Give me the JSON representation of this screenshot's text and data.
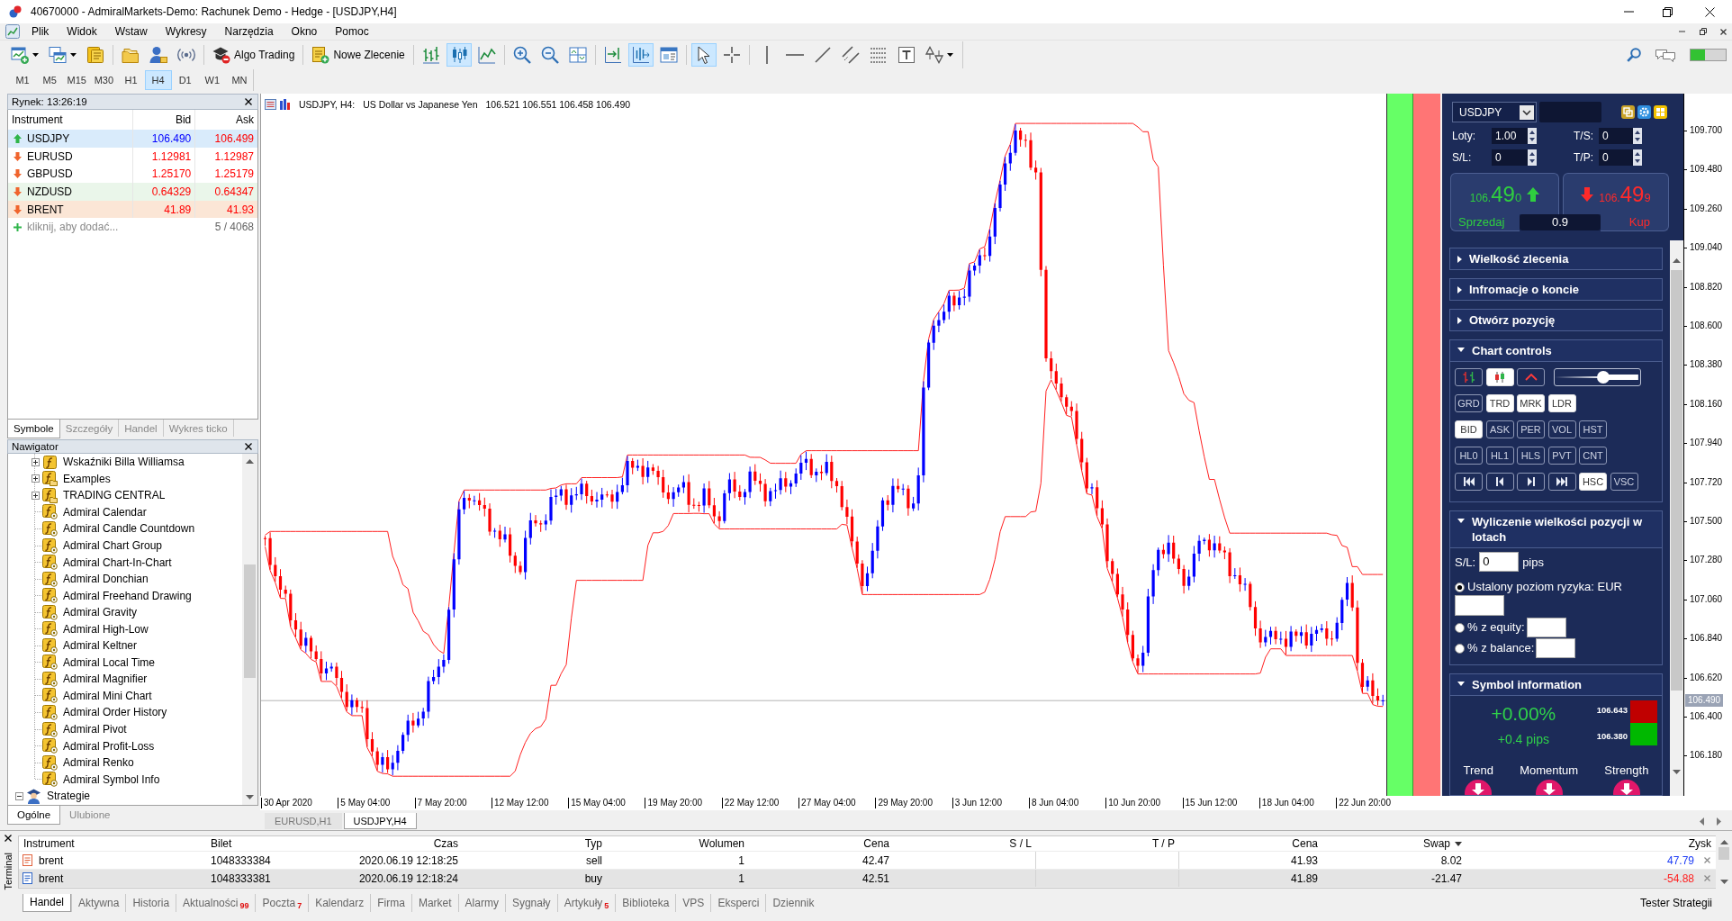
{
  "window": {
    "title": "40670000 - AdmiralMarkets-Demo: Rachunek Demo - Hedge - [USDJPY,H4]"
  },
  "menu": [
    "Plik",
    "Widok",
    "Wstaw",
    "Wykresy",
    "Narzędzia",
    "Okno",
    "Pomoc"
  ],
  "toolbar": {
    "groups": [
      [
        {
          "kind": "dropdown",
          "selected": false
        },
        {
          "kind": "dropdown",
          "selected": false
        },
        {
          "kind": "icon",
          "selected": false
        }
      ],
      [
        {
          "kind": "icon",
          "selected": false
        },
        {
          "kind": "icon",
          "selected": false
        },
        {
          "kind": "icon",
          "selected": false
        }
      ],
      [
        {
          "kind": "text",
          "label": "Algo Trading",
          "selected": false
        }
      ],
      [
        {
          "kind": "text",
          "label": "Nowe Zlecenie",
          "selected": false
        }
      ],
      [
        {
          "kind": "icon",
          "selected": false
        },
        {
          "kind": "icon",
          "selected": true
        },
        {
          "kind": "icon",
          "selected": false
        }
      ],
      [
        {
          "kind": "icon",
          "selected": false
        },
        {
          "kind": "icon",
          "selected": false
        },
        {
          "kind": "icon",
          "selected": false
        }
      ],
      [
        {
          "kind": "icon",
          "selected": false
        },
        {
          "kind": "icon",
          "selected": true
        },
        {
          "kind": "icon",
          "selected": false
        }
      ],
      [
        {
          "kind": "icon",
          "selected": true
        },
        {
          "kind": "icon",
          "selected": false
        }
      ],
      [
        {
          "kind": "icon",
          "selected": false
        },
        {
          "kind": "icon",
          "selected": false
        },
        {
          "kind": "icon",
          "selected": false
        },
        {
          "kind": "icon",
          "selected": false
        },
        {
          "kind": "icon",
          "selected": false
        },
        {
          "kind": "icon",
          "selected": false
        },
        {
          "kind": "dropdown",
          "selected": false
        }
      ]
    ]
  },
  "timeframes": [
    {
      "label": "M1",
      "selected": false
    },
    {
      "label": "M5",
      "selected": false
    },
    {
      "label": "M15",
      "selected": false
    },
    {
      "label": "M30",
      "selected": false
    },
    {
      "label": "H1",
      "selected": false
    },
    {
      "label": "H4",
      "selected": true
    },
    {
      "label": "D1",
      "selected": false
    },
    {
      "label": "W1",
      "selected": false
    },
    {
      "label": "MN",
      "selected": false
    }
  ],
  "market_watch": {
    "title": "Rynek: 13:26:19",
    "columns": [
      "Instrument",
      "Bid",
      "Ask"
    ],
    "rows": [
      {
        "symbol": "USDJPY",
        "bid": "106.490",
        "ask": "106.499",
        "bid_up": true,
        "ask_up": false,
        "selected": true
      },
      {
        "symbol": "EURUSD",
        "bid": "1.12981",
        "ask": "1.12987",
        "bid_up": false,
        "ask_up": false,
        "selected": false
      },
      {
        "symbol": "GBPUSD",
        "bid": "1.25170",
        "ask": "1.25179",
        "bid_up": false,
        "ask_up": false,
        "selected": false
      },
      {
        "symbol": "NZDUSD",
        "bid": "0.64329",
        "ask": "0.64347",
        "bid_up": false,
        "ask_up": false,
        "selected": false,
        "color": "#eaf6ea"
      },
      {
        "symbol": "BRENT",
        "bid": "41.89",
        "ask": "41.93",
        "bid_up": false,
        "ask_up": false,
        "selected": false,
        "color": "#fbe6d6"
      }
    ],
    "add_row": {
      "label": "kliknij, aby dodać...",
      "count": "5 / 4068"
    },
    "tabs": [
      {
        "label": "Symbole",
        "selected": true
      },
      {
        "label": "Szczegóły",
        "selected": false
      },
      {
        "label": "Handel",
        "selected": false
      },
      {
        "label": "Wykres ticko",
        "selected": false
      }
    ]
  },
  "navigator": {
    "title": "Nawigator",
    "tree": [
      {
        "children": [
          {
            "label": "Wskaźniki Billa Williamsa",
            "kind": "group",
            "expanded": false
          },
          {
            "label": "Examples",
            "kind": "folder",
            "expanded": false
          },
          {
            "label": "TRADING CENTRAL",
            "kind": "folder",
            "expanded": false
          },
          {
            "label": "Admiral Calendar",
            "kind": "indicator"
          },
          {
            "label": "Admiral Candle Countdown",
            "kind": "indicator"
          },
          {
            "label": "Admiral Chart Group",
            "kind": "indicator"
          },
          {
            "label": "Admiral Chart-In-Chart",
            "kind": "indicator"
          },
          {
            "label": "Admiral Donchian",
            "kind": "indicator"
          },
          {
            "label": "Admiral Freehand Drawing",
            "kind": "indicator"
          },
          {
            "label": "Admiral Gravity",
            "kind": "indicator"
          },
          {
            "label": "Admiral High-Low",
            "kind": "indicator"
          },
          {
            "label": "Admiral Keltner",
            "kind": "indicator"
          },
          {
            "label": "Admiral Local Time",
            "kind": "indicator"
          },
          {
            "label": "Admiral Magnifier",
            "kind": "indicator"
          },
          {
            "label": "Admiral Mini Chart",
            "kind": "indicator"
          },
          {
            "label": "Admiral Order History",
            "kind": "indicator"
          },
          {
            "label": "Admiral Pivot",
            "kind": "indicator"
          },
          {
            "label": "Admiral Profit-Loss",
            "kind": "indicator"
          },
          {
            "label": "Admiral Renko",
            "kind": "indicator"
          },
          {
            "label": "Admiral Symbol Info",
            "kind": "indicator"
          }
        ]
      },
      {
        "label": "Strategie",
        "kind": "experts",
        "expanded": true
      }
    ],
    "tabs": [
      {
        "label": "Ogólne",
        "selected": true
      },
      {
        "label": "Ulubione",
        "selected": false
      }
    ]
  },
  "chart": {
    "symbol": "USDJPY, H4:",
    "description": "US Dollar vs Japanese Yen",
    "ohlc": "106.521 106.551 106.458 106.490",
    "price_labels": [
      "109.700",
      "109.480",
      "109.260",
      "109.040",
      "108.820",
      "108.600",
      "108.380",
      "108.160",
      "107.940",
      "107.720",
      "107.500",
      "107.280",
      "107.060",
      "106.840",
      "106.620",
      "106.400",
      "106.180"
    ],
    "current_price": "106.490",
    "time_labels": [
      "30 Apr 2020",
      "5 May 04:00",
      "7 May 20:00",
      "12 May 12:00",
      "15 May 04:00",
      "19 May 20:00",
      "22 May 12:00",
      "27 May 04:00",
      "29 May 20:00",
      "3 Jun 12:00",
      "8 Jun 04:00",
      "10 Jun 20:00",
      "15 Jun 12:00",
      "18 Jun 04:00",
      "22 Jun 20:00"
    ],
    "tabs": [
      {
        "label": "EURUSD,H1",
        "selected": false
      },
      {
        "label": "USDJPY,H4",
        "selected": true
      }
    ]
  },
  "trade_panel": {
    "symbol": "USDJPY",
    "fields": [
      {
        "label": "Loty:",
        "value": "1.00"
      },
      {
        "label": "T/S:",
        "value": "0"
      },
      {
        "label": "S/L:",
        "value": "0"
      },
      {
        "label": "T/P:",
        "value": "0"
      }
    ],
    "sell": {
      "price_prefix": "106.",
      "price_main": "49",
      "price_suffix": "0",
      "label": "Sprzedaj"
    },
    "buy": {
      "price_prefix": "106.",
      "price_main": "49",
      "price_suffix": "9",
      "label": "Kup"
    },
    "spread": "0.9",
    "sections": [
      {
        "kind": "plain",
        "title": "Wielkość zlecenia",
        "expanded": false
      },
      {
        "kind": "plain",
        "title": "Infromacje o koncie",
        "expanded": false
      },
      {
        "kind": "plain",
        "title": "Otwórz pozycję",
        "expanded": false
      },
      {
        "kind": "chart_controls",
        "title": "Chart controls",
        "expanded": true,
        "rows": [
          [
            {
              "kind": "icon",
              "on": false
            },
            {
              "kind": "icon",
              "on": true
            },
            {
              "kind": "icon",
              "on": false
            },
            {
              "kind": "slider",
              "level": 0.57
            }
          ],
          [
            {
              "kind": "text",
              "label": "GRD",
              "on": false
            },
            {
              "kind": "text",
              "label": "TRD",
              "on": true
            },
            {
              "kind": "text",
              "label": "MRK",
              "on": true
            },
            {
              "kind": "text",
              "label": "LDR",
              "on": true
            }
          ],
          [
            {
              "kind": "text",
              "label": "BID",
              "on": true
            },
            {
              "kind": "text",
              "label": "ASK",
              "on": false
            },
            {
              "kind": "text",
              "label": "PER",
              "on": false
            },
            {
              "kind": "text",
              "label": "VOL",
              "on": false
            },
            {
              "kind": "text",
              "label": "HST",
              "on": false
            }
          ],
          [
            {
              "kind": "text",
              "label": "HL0",
              "on": false
            },
            {
              "kind": "text",
              "label": "HL1",
              "on": false
            },
            {
              "kind": "text",
              "label": "HLS",
              "on": false
            },
            {
              "kind": "text",
              "label": "PVT",
              "on": false
            },
            {
              "kind": "text",
              "label": "CNT",
              "on": false
            }
          ],
          [
            {
              "kind": "icon",
              "on": false
            },
            {
              "kind": "icon",
              "on": false
            },
            {
              "kind": "icon",
              "on": false
            },
            {
              "kind": "icon",
              "on": false
            },
            {
              "kind": "text",
              "label": "HSC",
              "on": true
            },
            {
              "kind": "text",
              "label": "VSC",
              "on": false
            }
          ]
        ]
      },
      {
        "kind": "position_size",
        "title": "Wyliczenie wielkości pozycji w lotach",
        "expanded": true,
        "stop_loss": {
          "label": "S/L:",
          "value": "0",
          "unit": "pips"
        },
        "options": [
          {
            "label": "Ustalony poziom ryzyka: EUR",
            "selected": true
          },
          {
            "label": "% z equity:",
            "selected": false
          },
          {
            "label": "% z balance:",
            "selected": false
          }
        ]
      },
      {
        "kind": "symbol_info",
        "title": "Symbol information",
        "expanded": true,
        "change": "+0.00%",
        "pips": "+0.4 pips",
        "high": "106.643",
        "low": "106.380",
        "indicators": [
          {
            "label": "Trend",
            "falling": true
          },
          {
            "label": "Momentum",
            "falling": true
          },
          {
            "label": "Strength",
            "falling": true
          }
        ]
      }
    ]
  },
  "terminal": {
    "side_label": "Terminal",
    "columns": [
      {
        "label": "Instrument",
        "sorted": false
      },
      {
        "label": "Bilet",
        "sorted": false
      },
      {
        "label": "Czas",
        "sorted": false
      },
      {
        "label": "Typ",
        "sorted": false
      },
      {
        "label": "Wolumen",
        "sorted": false
      },
      {
        "label": "Cena",
        "sorted": false
      },
      {
        "label": "S / L",
        "sorted": false
      },
      {
        "label": "T / P",
        "sorted": false
      },
      {
        "label": "Cena",
        "sorted": false
      },
      {
        "label": "Swap",
        "sorted": true
      },
      {
        "label": "Zysk",
        "sorted": false
      }
    ],
    "rows": [
      {
        "kind": "sell",
        "instrument": "brent",
        "ticket": "1048333384",
        "time": "2020.06.19 12:18:25",
        "type": "sell",
        "volume": "1",
        "open_price": "42.47",
        "price": "41.93",
        "swap": "8.02",
        "profit": "47.79",
        "loss": false,
        "selected": false
      },
      {
        "kind": "buy",
        "instrument": "brent",
        "ticket": "1048333381",
        "time": "2020.06.19 12:18:24",
        "type": "buy",
        "volume": "1",
        "open_price": "42.51",
        "price": "41.89",
        "swap": "-21.47",
        "profit": "-54.88",
        "loss": true,
        "selected": true
      }
    ],
    "tabs": [
      {
        "label": "Handel",
        "selected": true
      },
      {
        "label": "Aktywna",
        "selected": false
      },
      {
        "label": "Historia",
        "selected": false
      },
      {
        "label": "Aktualności",
        "badge": "99",
        "selected": false
      },
      {
        "label": "Poczta",
        "badge": "7",
        "selected": false
      },
      {
        "label": "Kalendarz",
        "selected": false
      },
      {
        "label": "Firma",
        "selected": false
      },
      {
        "label": "Market",
        "selected": false
      },
      {
        "label": "Alarmy",
        "selected": false
      },
      {
        "label": "Sygnały",
        "selected": false
      },
      {
        "label": "Artykuły",
        "badge": "5",
        "selected": false
      },
      {
        "label": "Biblioteka",
        "selected": false
      },
      {
        "label": "VPS",
        "selected": false
      },
      {
        "label": "Eksperci",
        "selected": false
      },
      {
        "label": "Dziennik",
        "selected": false
      }
    ],
    "tester": "Tester Strategii"
  }
}
